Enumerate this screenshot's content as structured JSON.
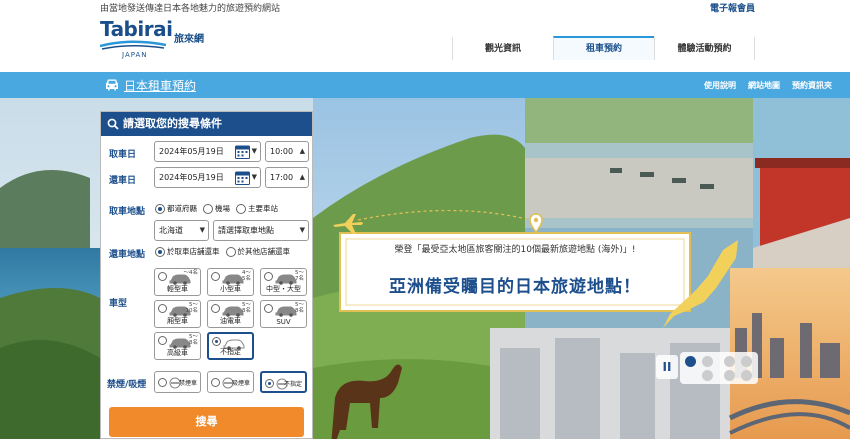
{
  "header": {
    "tagline": "由當地發送傳達日本各地魅力的旅遊預約網站",
    "logo_word": "Tabirai",
    "logo_japan": "JAPAN",
    "logo_sub": "旅來網",
    "member_link": "電子報會員",
    "nav": [
      "觀光資訊",
      "租車預約",
      "體驗活動預約"
    ]
  },
  "bar": {
    "title": "日本租車預約",
    "links": [
      "使用說明",
      "網站地圖",
      "預約資訊夾"
    ]
  },
  "search": {
    "heading": "請選取您的搜尋條件",
    "pickup_label": "取車日",
    "pickup_date": "2024年05月19日",
    "pickup_time": "10:00",
    "return_label": "還車日",
    "return_date": "2024年05月19日",
    "return_time": "17:00",
    "location_label": "取車地點",
    "location_options": [
      "都道府縣",
      "機場",
      "主要車站"
    ],
    "prefecture": "北海道",
    "store_placeholder": "請選擇取車地點",
    "return_location_label": "還車地點",
    "return_options": [
      "於取車店舖還車",
      "於其他店舖還車"
    ],
    "cartype_label": "車型",
    "cartypes": [
      {
        "cap1": "～4名",
        "cap2": "",
        "name": "輕型車"
      },
      {
        "cap1": "4～",
        "cap2": "5名",
        "name": "小型車"
      },
      {
        "cap1": "5～",
        "cap2": "7名",
        "name": "中型・大型"
      },
      {
        "cap1": "5～",
        "cap2": "10名",
        "name": "厢型車"
      },
      {
        "cap1": "5～",
        "cap2": "8名",
        "name": "油電車"
      },
      {
        "cap1": "5～",
        "cap2": "8名",
        "name": "SUV"
      },
      {
        "cap1": "5～",
        "cap2": "8名",
        "name": "高級車"
      },
      {
        "cap1": "",
        "cap2": "",
        "name": "不指定"
      }
    ],
    "smoking_label": "禁煙/吸煙",
    "smoking_options": [
      "禁煙車",
      "吸煙車",
      "不指定"
    ],
    "search_button": "搜尋"
  },
  "banner": {
    "subtitle": "榮登「最受亞太地區旅客關注的10個最新旅遊地點 (海外)」!",
    "title": "亞洲備受矚目的日本旅遊地點！"
  },
  "slider": {
    "pause_label": "II",
    "active_index": 0,
    "count": 4
  },
  "colors": {
    "navy": "#1d4f8c",
    "sky": "#4aa8e0",
    "orange": "#f08a2a"
  },
  "icons": [
    "car-icon",
    "search-icon",
    "calendar-icon",
    "chevron-down-icon",
    "airplane-icon",
    "location-pin-icon",
    "pause-icon"
  ]
}
